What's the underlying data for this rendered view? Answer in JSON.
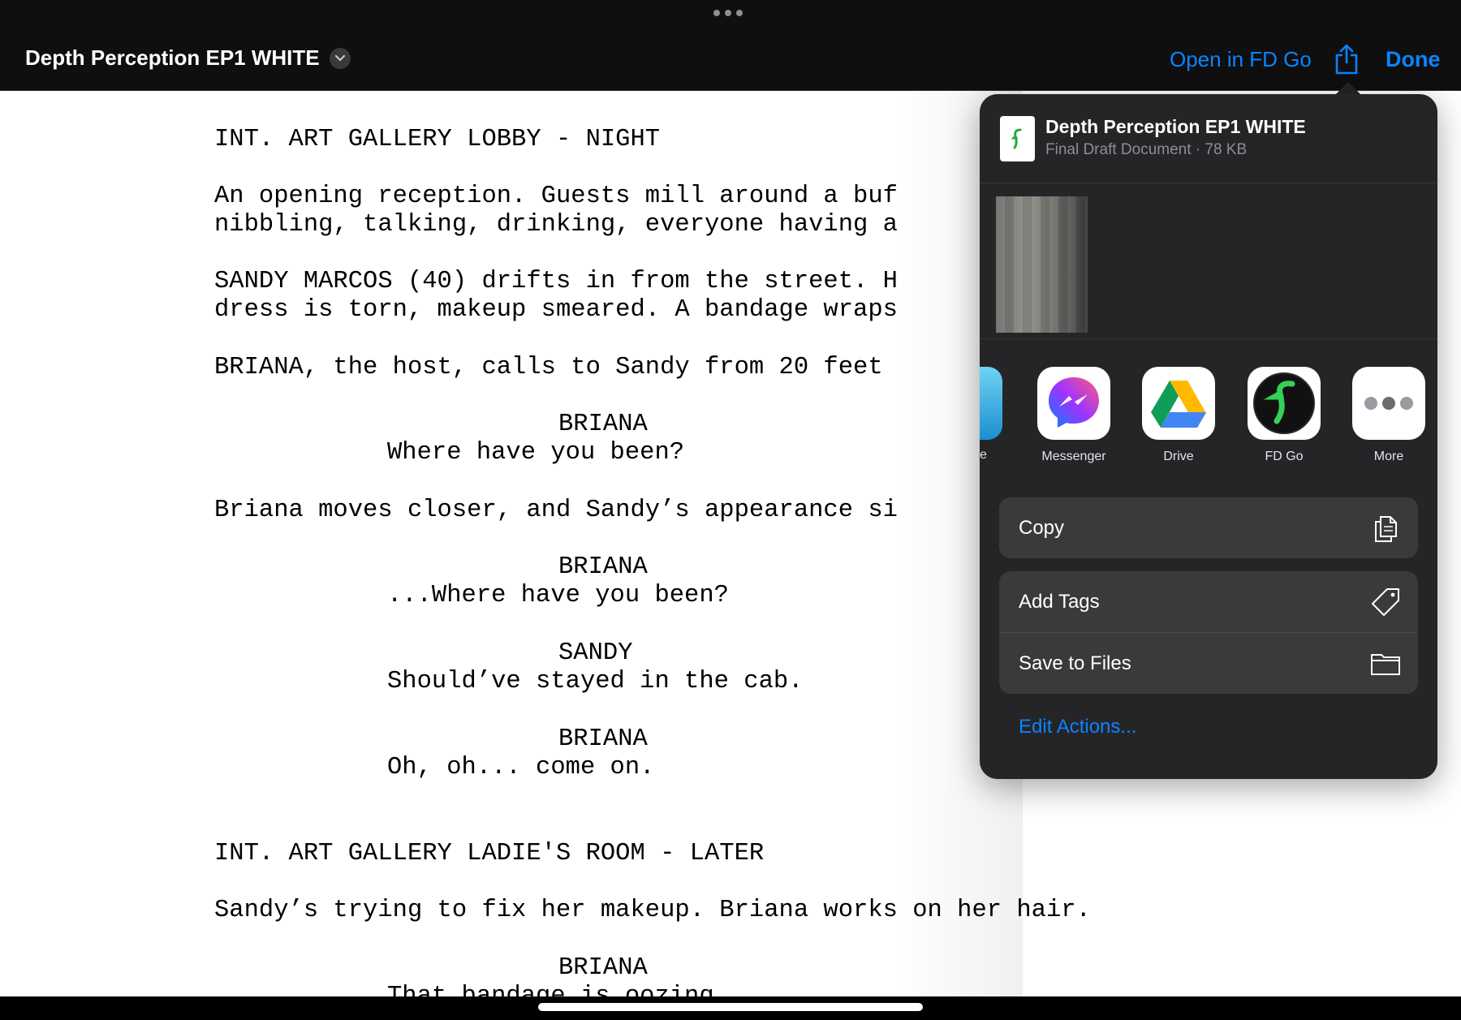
{
  "header": {
    "document_title": "Depth Perception EP1 WHITE",
    "open_in_label": "Open in FD Go",
    "done_label": "Done"
  },
  "script": {
    "lines": [
      "INT. ART GALLERY LOBBY - NIGHT",
      "An opening reception. Guests mill around a buf",
      "nibbling, talking, drinking, everyone having a",
      "SANDY MARCOS (40) drifts in from the street. H",
      "dress is torn, makeup smeared. A bandage wraps",
      "BRIANA, the host, calls to Sandy from 20 feet",
      "BRIANA",
      "Where have you been?",
      "Briana moves closer, and Sandy’s appearance si",
      "BRIANA",
      "...Where have you been?",
      "SANDY",
      "Should’ve stayed in the cab.",
      "BRIANA",
      "Oh, oh... come on.",
      "INT. ART GALLERY LADIE'S ROOM - LATER",
      "Sandy’s trying to fix her makeup. Briana works on her hair.",
      "BRIANA",
      "That bandage is oozing."
    ]
  },
  "share_sheet": {
    "file_name": "Depth Perception EP1 WHITE",
    "file_meta": "Final Draft Document · 78 KB",
    "partial_app_label": "e",
    "apps": [
      {
        "label": "Messenger",
        "icon": "messenger-icon"
      },
      {
        "label": "Drive",
        "icon": "google-drive-icon"
      },
      {
        "label": "FD Go",
        "icon": "fd-go-icon"
      },
      {
        "label": "More",
        "icon": "more-icon"
      }
    ],
    "actions_group1": [
      {
        "label": "Copy",
        "icon": "copy-icon"
      }
    ],
    "actions_group2": [
      {
        "label": "Add Tags",
        "icon": "tag-icon"
      },
      {
        "label": "Save to Files",
        "icon": "folder-icon"
      }
    ],
    "edit_actions_label": "Edit Actions..."
  },
  "colors": {
    "accent": "#0a84ff",
    "sheet_bg": "#252527",
    "row_bg": "#3a3a3c"
  }
}
